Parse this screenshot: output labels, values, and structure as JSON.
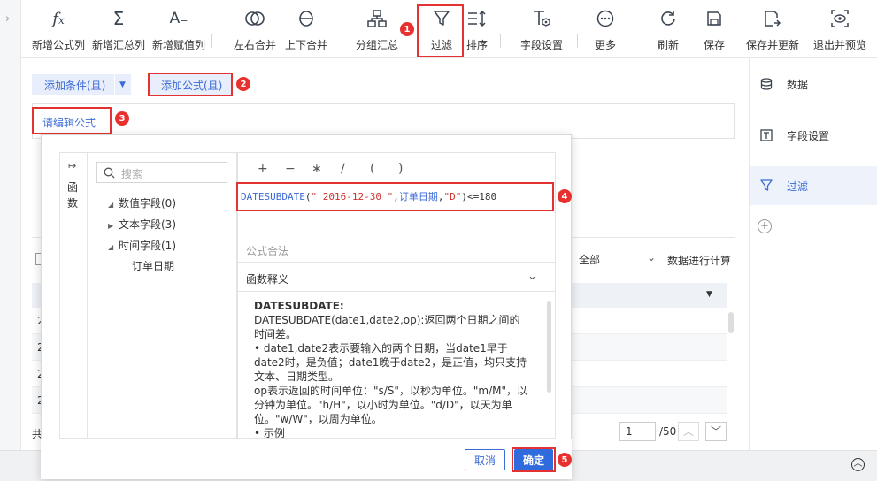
{
  "toolbar": {
    "buttons": [
      {
        "label": "新增公式列",
        "icon": "fx-icon"
      },
      {
        "label": "新增汇总列",
        "icon": "sigma-icon"
      },
      {
        "label": "新增赋值列",
        "icon": "assign-icon"
      },
      {
        "label": "左右合并",
        "icon": "merge-lr-icon"
      },
      {
        "label": "上下合并",
        "icon": "merge-ud-icon"
      },
      {
        "label": "分组汇总",
        "icon": "group-icon"
      },
      {
        "label": "过滤",
        "icon": "filter-icon"
      },
      {
        "label": "排序",
        "icon": "sort-icon"
      },
      {
        "label": "字段设置",
        "icon": "field-settings-icon"
      },
      {
        "label": "更多",
        "icon": "more-icon"
      },
      {
        "label": "刷新",
        "icon": "refresh-icon"
      },
      {
        "label": "保存",
        "icon": "save-icon"
      },
      {
        "label": "保存并更新",
        "icon": "save-update-icon"
      },
      {
        "label": "退出并预览",
        "icon": "preview-icon"
      }
    ]
  },
  "filter_area": {
    "add_condition_label": "添加条件(且)",
    "add_formula_label": "添加公式(且)",
    "formula_placeholder_link": "请编辑公式"
  },
  "right_panel": {
    "items": [
      {
        "label": "数据",
        "icon": "database-icon"
      },
      {
        "label": "字段设置",
        "icon": "text-field-icon"
      },
      {
        "label": "过滤",
        "icon": "filter-icon"
      }
    ],
    "add_label": "+"
  },
  "background": {
    "scope_select": "全部",
    "calc_label": "数据进行计算",
    "row_prefix": [
      "2",
      "2",
      "2",
      "2"
    ],
    "footer_prefix": "共",
    "page_input": "1",
    "page_total": "/50"
  },
  "dialog": {
    "side_tab": "函数",
    "search_placeholder": "搜索",
    "tree": [
      {
        "label": "数值字段(0)",
        "expanded": false
      },
      {
        "label": "文本字段(3)",
        "expanded": false
      },
      {
        "label": "时间字段(1)",
        "expanded": true,
        "children": [
          "订单日期"
        ]
      }
    ],
    "operators": [
      "+",
      "−",
      "∗",
      "/",
      "(",
      ")"
    ],
    "formula": {
      "func": "DATESUBDATE",
      "open": "(",
      "date_literal": "\" 2016-12-30 \"",
      "comma1": ",",
      "field": "订单日期",
      "comma2": ",",
      "unit_literal": "\"D\"",
      "tail": ")<=180"
    },
    "validity": "公式合法",
    "func_section_title": "函数释义",
    "func_doc": {
      "name": "DATESUBDATE:",
      "signature": "DATESUBDATE(date1,date2,op):返回两个日期之间的时间差。",
      "p1": "• date1,date2表示要输入的两个日期，当date1早于date2时，是负值；date1晚于date2，是正值，均只支持文本、日期类型。",
      "p2": "op表示返回的时间单位：\"s/S\"，以秒为单位。\"m/M\"，以分钟为单位。\"h/H\"，以小时为单位。\"d/D\"，以天为单位。\"w/W\"，以周为单位。",
      "p3": "• 示例"
    },
    "cancel_label": "取消",
    "confirm_label": "确定"
  },
  "annotations": [
    "1",
    "2",
    "3",
    "4",
    "5"
  ],
  "colors": {
    "accent": "#3c6bd6",
    "annotation_red": "#e23232",
    "formula_blue": "#3c6bd6",
    "formula_red": "#d0312d",
    "confirm_bg": "#2f6bdc"
  }
}
